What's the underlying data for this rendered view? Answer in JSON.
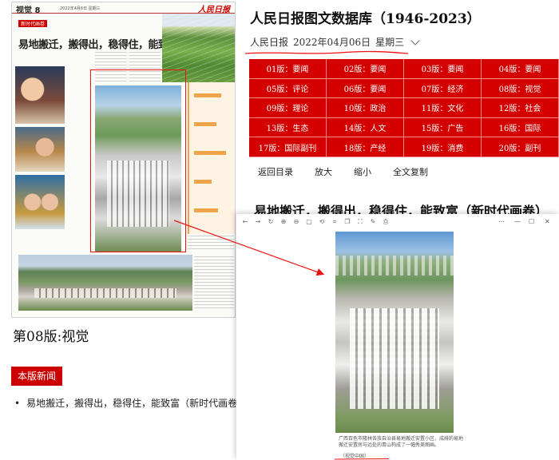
{
  "paper_thumbnail": {
    "section": "视觉 8",
    "date_line": "2022年4月6日 星期三",
    "masthead": "人民日报",
    "column_tag": "新时代画卷",
    "headline": "易地搬迁，搬得出，稳得住，能致富"
  },
  "edition_label": "第08版:视觉",
  "news_tag": "本版新闻",
  "news_items": [
    "易地搬迁，搬得出，稳得住，能致富（新时代画卷）"
  ],
  "database": {
    "title": "人民日报图文数据库（1946-2023）",
    "paper_name": "人民日报",
    "date": "2022年04月06日",
    "weekday": "星期三"
  },
  "pages": [
    "01版：要闻",
    "02版：要闻",
    "03版：要闻",
    "04版：要闻",
    "05版：评论",
    "06版：要闻",
    "07版：经济",
    "08版：视觉",
    "09版：理论",
    "10版：政治",
    "11版：文化",
    "12版：社会",
    "13版：生态",
    "14版：人文",
    "15版：广告",
    "16版：国际",
    "17版：国际副刊",
    "18版：产经",
    "19版：消费",
    "20版：副刊"
  ],
  "toolbar": {
    "back": "返回目录",
    "zoom_in": "放大",
    "zoom_out": "缩小",
    "copy_all": "全文复制"
  },
  "article_title": "易地搬迁，搬得出，稳得住，能致富（新时代画卷）",
  "viewer": {
    "caption": "广西百色市隆林各族自治县易地搬迁安置小区，成排的易地搬迁安置房与远处的青山构成了一幅秀美图画。",
    "credit": "（视觉中国）"
  },
  "colors": {
    "accent": "#d40000",
    "highlight": "#ee1111"
  }
}
